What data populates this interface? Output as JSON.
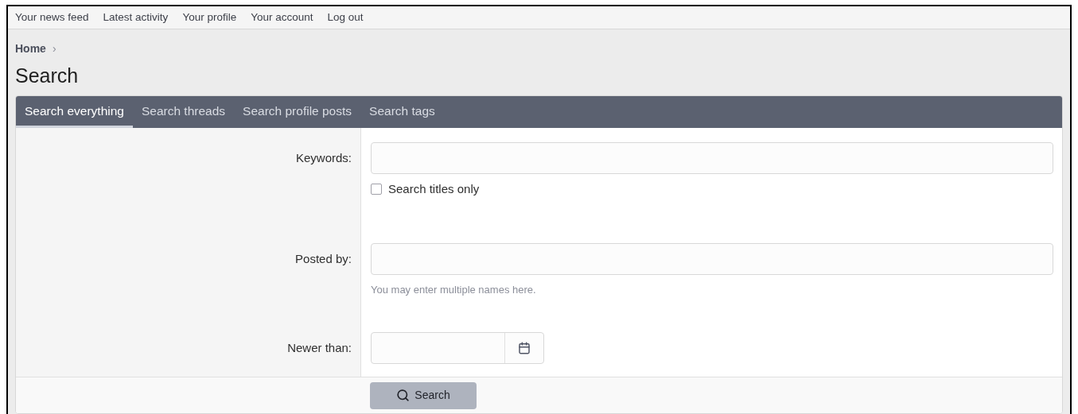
{
  "top_nav": [
    "Your news feed",
    "Latest activity",
    "Your profile",
    "Your account",
    "Log out"
  ],
  "breadcrumb": {
    "label": "Home",
    "separator": "›"
  },
  "title": "Search",
  "tabs": [
    {
      "label": "Search everything",
      "selected": true
    },
    {
      "label": "Search threads",
      "selected": false
    },
    {
      "label": "Search profile posts",
      "selected": false
    },
    {
      "label": "Search tags",
      "selected": false
    }
  ],
  "form": {
    "rows": [
      {
        "kind": "text",
        "label": "Keywords:",
        "checkbox": {
          "label": "Search titles only",
          "checked": false
        }
      },
      {
        "kind": "text",
        "label": "Posted by:",
        "hint": "You may enter multiple names here."
      },
      {
        "kind": "date",
        "label": "Newer than:"
      }
    ]
  },
  "submit": {
    "label": "Search"
  }
}
